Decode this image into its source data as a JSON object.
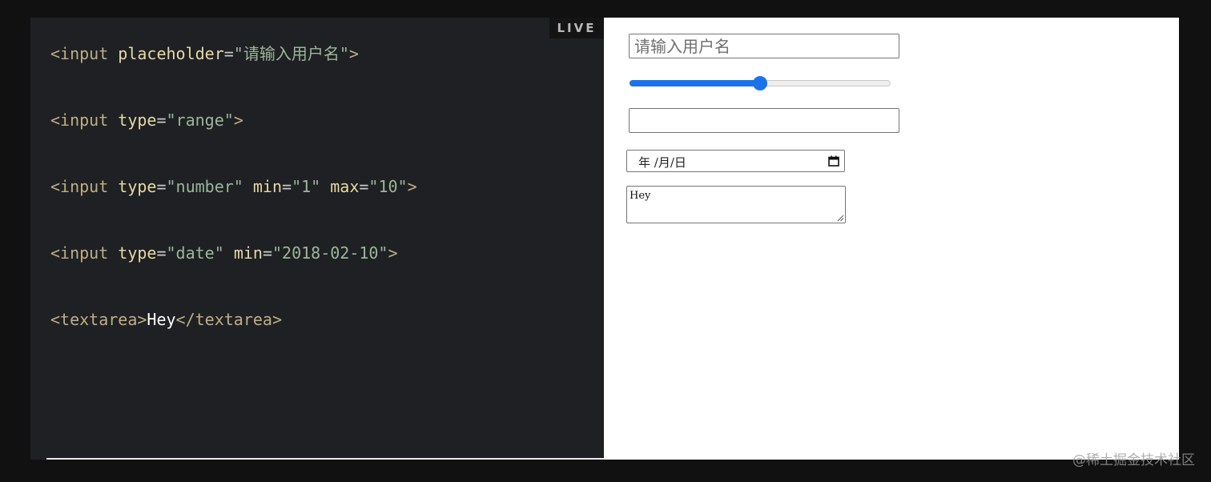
{
  "live_badge": "LIVE",
  "code": {
    "line1": {
      "open": "<input",
      "attr": "placeholder",
      "eq": "=",
      "value": "\"请输入用户名\"",
      "close": ">"
    },
    "line2": {
      "open": "<input",
      "attr": "type",
      "eq": "=",
      "value": "\"range\"",
      "close": ">"
    },
    "line3": {
      "open": "<input",
      "attr1": "type",
      "eq1": "=",
      "value1": "\"number\"",
      "attr2": "min",
      "eq2": "=",
      "value2": "\"1\"",
      "attr3": "max",
      "eq3": "=",
      "value3": "\"10\"",
      "close": ">"
    },
    "line4": {
      "open": "<input",
      "attr1": "type",
      "eq1": "=",
      "value1": "\"date\"",
      "attr2": "min",
      "eq2": "=",
      "value2": "\"2018-02-10\"",
      "close": ">"
    },
    "line5": {
      "open_tag": "<textarea>",
      "content": "Hey",
      "close_tag": "</textarea>"
    }
  },
  "preview": {
    "text_input_placeholder": "请输入用户名",
    "text_input_value": "",
    "range": {
      "min": 0,
      "max": 100,
      "value": 50
    },
    "number_input_value": "",
    "number_min": "1",
    "number_max": "10",
    "date_placeholder": "年 /月/日",
    "date_min": "2018-02-10",
    "textarea_value": "Hey",
    "accent_color": "#1a73e8"
  },
  "watermark": "@稀土掘金技术社区"
}
